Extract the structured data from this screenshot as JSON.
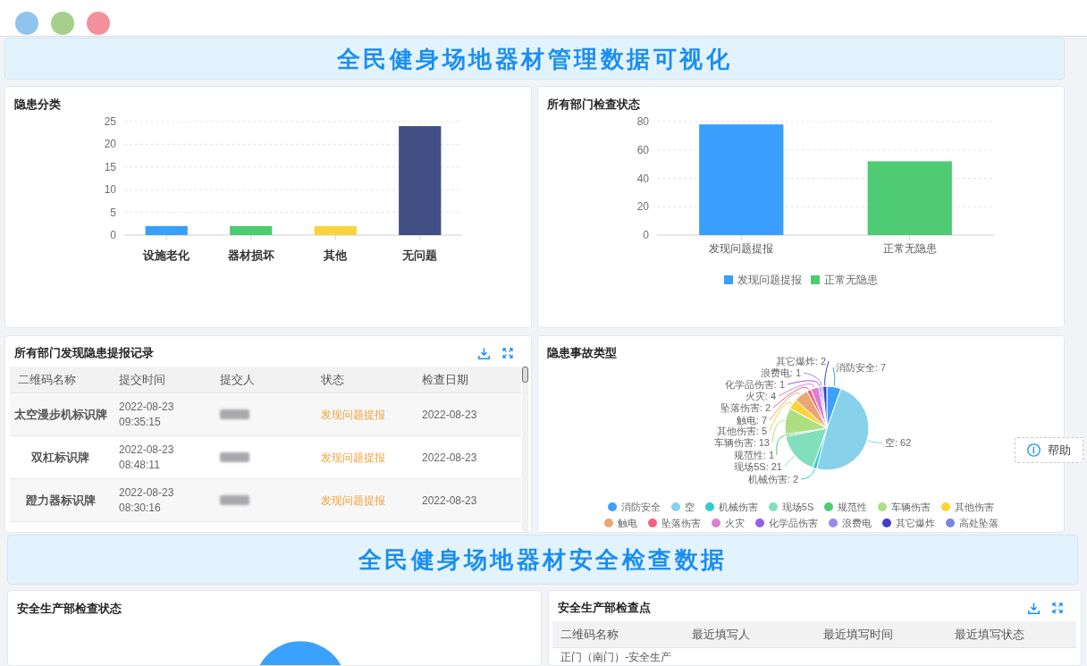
{
  "window": {
    "buttons": [
      {
        "color": "#8fc4ef"
      },
      {
        "color": "#a6cf8c"
      },
      {
        "color": "#f3909c"
      }
    ]
  },
  "overview": {
    "banner": "全民健身场地器材管理数据可视化",
    "hazard_category": {
      "title": "隐患分类",
      "chart_data": {
        "type": "bar",
        "categories": [
          "设施老化",
          "器材损坏",
          "其他",
          "无问题"
        ],
        "series": [
          {
            "color": "#3a9ffc",
            "values": [
              2,
              null,
              null,
              null
            ]
          },
          {
            "color": "#4ccb72",
            "values": [
              null,
              2,
              null,
              null
            ]
          },
          {
            "color": "#fbd33f",
            "values": [
              null,
              null,
              2,
              null
            ]
          },
          {
            "color": "#424f85",
            "values": [
              null,
              null,
              null,
              24
            ]
          }
        ],
        "stacked": true,
        "grid": true,
        "ylim": [
          0,
          25
        ],
        "yticks": [
          0,
          5,
          10,
          15,
          20,
          25
        ]
      }
    },
    "department_status": {
      "title": "所有部门检查状态",
      "chart_data": {
        "type": "bar",
        "categories": [
          "发现问题提报",
          "正常无隐患"
        ],
        "series": [
          {
            "name": "发现问题提报",
            "color": "#3a9ffc",
            "values": [
              78,
              null
            ]
          },
          {
            "name": "正常无隐患",
            "color": "#4ecb73",
            "values": [
              null,
              52
            ]
          }
        ],
        "stacked": true,
        "grid": true,
        "ylim": [
          0,
          80
        ],
        "yticks": [
          0,
          20,
          40,
          60,
          80
        ]
      }
    },
    "hazard_records": {
      "title": "所有部门发现隐患提报记录",
      "columns": [
        "二维码名称",
        "提交时间",
        "提交人",
        "状态",
        "检查日期"
      ],
      "rows": [
        {
          "name": "太空漫步机标识牌",
          "submit_time": "2022-08-23 09:35:15",
          "submitter_blurred": true,
          "status": "发现问题提报",
          "check_date": "2022-08-23"
        },
        {
          "name": "双杠标识牌",
          "submit_time": "2022-08-23 08:48:11",
          "submitter_blurred": true,
          "status": "发现问题提报",
          "check_date": "2022-08-23"
        },
        {
          "name": "蹬力器标识牌",
          "submit_time": "2022-08-23 08:30:16",
          "submitter_blurred": true,
          "status": "发现问题提报",
          "check_date": "2022-08-23"
        }
      ]
    },
    "accident_types": {
      "title": "隐患事故类型",
      "chart_data": {
        "type": "pie",
        "categories": [
          "消防安全",
          "空",
          "机械伤害",
          "现场5S",
          "规范性",
          "车辆伤害",
          "其他伤害",
          "触电",
          "坠落伤害",
          "火灾",
          "化学品伤害",
          "浪费电",
          "其它爆炸",
          "高处坠落"
        ],
        "values": [
          7,
          62,
          2,
          21,
          1,
          13,
          5,
          7,
          2,
          4,
          1,
          1,
          2,
          null
        ],
        "value_labels": [
          "消防安全: 7",
          "空: 62",
          "机械伤害: 2",
          "现场5S: 21",
          "规范性: 1",
          "车辆伤害: 13",
          "其他伤害: 5",
          "触电: 7",
          "坠落伤害: 2",
          "火灾: 4",
          "化学品伤害: 1",
          "浪费电: 1",
          "其它爆炸: 2",
          null
        ]
      },
      "legend": [
        {
          "color": "#3ba1ff"
        },
        {
          "color": "#88d1ea"
        },
        {
          "color": "#36cbcb"
        },
        {
          "color": "#82dfbe"
        },
        {
          "color": "#4ecb73"
        },
        {
          "color": "#acdf82"
        },
        {
          "color": "#fbd437"
        },
        {
          "color": "#eaa674"
        },
        {
          "color": "#f2637b"
        },
        {
          "color": "#dc81d2"
        },
        {
          "color": "#975fe5"
        },
        {
          "color": "#9a8ae8"
        },
        {
          "color": "#4040c8"
        },
        {
          "color": "#7b86e0"
        }
      ]
    }
  },
  "safety": {
    "banner": "全民健身场地器材安全检查数据",
    "department_status": {
      "title": "安全生产部检查状态"
    },
    "checkpoints": {
      "title": "安全生产部检查点",
      "columns": [
        "二维码名称",
        "最近填写人",
        "最近填写时间",
        "最近填写状态"
      ],
      "rows": [
        {
          "cells": [
            "正门（南门）-安全生产"
          ]
        }
      ]
    }
  },
  "help_button": {
    "label": "帮助"
  }
}
